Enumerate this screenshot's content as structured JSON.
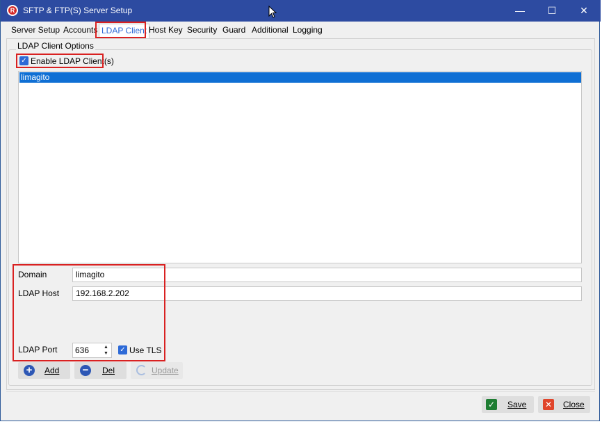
{
  "window": {
    "title": "SFTP & FTP(S) Server Setup",
    "app_icon_letter": "R",
    "minimize_glyph": "—",
    "maximize_glyph": "☐",
    "close_glyph": "✕"
  },
  "tabs": [
    {
      "label": "Server Setup"
    },
    {
      "label": "Accounts"
    },
    {
      "label": "LDAP Client",
      "active": true
    },
    {
      "label": "Host Key"
    },
    {
      "label": "Security"
    },
    {
      "label": "Guard"
    },
    {
      "label": "Additional"
    },
    {
      "label": "Logging"
    }
  ],
  "ldap": {
    "group_title": "LDAP Client Options",
    "enable_label": "Enable LDAP Client(s)",
    "enable_checked": true,
    "list_items": [
      "limagito"
    ],
    "domain_label": "Domain",
    "domain_value": "limagito",
    "host_label": "LDAP Host",
    "host_value": "192.168.2.202",
    "port_label": "LDAP Port",
    "port_value": "636",
    "tls_label": "Use TLS",
    "tls_checked": true
  },
  "buttons": {
    "add": "Add",
    "del": "Del",
    "update": "Update",
    "save": "Save",
    "close": "Close"
  },
  "colors": {
    "titlebar": "#2d4ba1",
    "accent": "#2d6ad7",
    "selection": "#0f6fd4",
    "highlight": "#d92121",
    "save_icon": "#1e7d32",
    "close_icon": "#e0452b"
  }
}
